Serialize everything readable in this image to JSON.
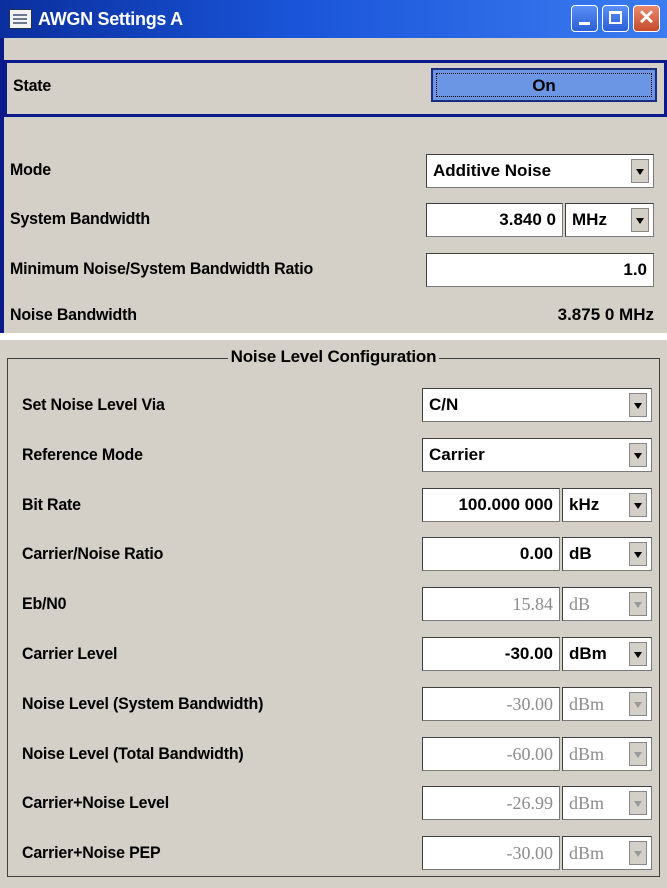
{
  "window": {
    "title": "AWGN Settings A",
    "icon": "window-icon",
    "controls": [
      "minimize-icon",
      "maximize-icon",
      "close-icon"
    ],
    "close_glyph": "✕"
  },
  "state": {
    "label": "State",
    "value": "On"
  },
  "mode": {
    "label": "Mode",
    "value": "Additive Noise"
  },
  "system_bandwidth": {
    "label": "System Bandwidth",
    "value": "3.840 0",
    "unit": "MHz"
  },
  "min_ratio": {
    "label": "Minimum Noise/System Bandwidth Ratio",
    "value": "1.0"
  },
  "noise_bandwidth": {
    "label": "Noise Bandwidth",
    "value": "3.875 0 MHz"
  },
  "noise_config": {
    "title": "Noise Level Configuration",
    "rows": [
      {
        "label": "Set Noise Level Via",
        "value": "C/N",
        "type": "select"
      },
      {
        "label": "Reference Mode",
        "value": "Carrier",
        "type": "select"
      },
      {
        "label": "Bit Rate",
        "value": "100.000 000",
        "unit": "kHz",
        "type": "number"
      },
      {
        "label": "Carrier/Noise Ratio",
        "value": "0.00",
        "unit": "dB",
        "type": "number"
      },
      {
        "label": "Eb/N0",
        "value": "15.84",
        "unit": "dB",
        "type": "disabled"
      },
      {
        "label": "Carrier Level",
        "value": "-30.00",
        "unit": "dBm",
        "type": "number"
      },
      {
        "label": "Noise Level (System Bandwidth)",
        "value": "-30.00",
        "unit": "dBm",
        "type": "disabled"
      },
      {
        "label": "Noise Level (Total Bandwidth)",
        "value": "-60.00",
        "unit": "dBm",
        "type": "disabled"
      },
      {
        "label": "Carrier+Noise Level",
        "value": "-26.99",
        "unit": "dBm",
        "type": "disabled"
      },
      {
        "label": "Carrier+Noise PEP",
        "value": "-30.00",
        "unit": "dBm",
        "type": "disabled"
      }
    ]
  },
  "colors": {
    "title_bar": "#1a55d9",
    "panel_bg": "#d4d0c8",
    "state_button": "#6b96e4",
    "focus_border": "#0a1a8a",
    "disabled_text": "#8c8c8c"
  }
}
